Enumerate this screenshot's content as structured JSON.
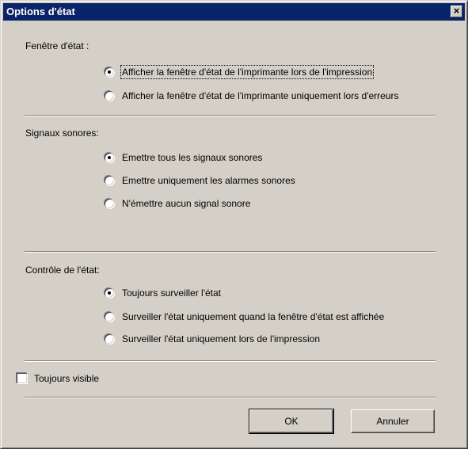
{
  "window": {
    "title": "Options d'état",
    "close_glyph": "×"
  },
  "status_window": {
    "label": "Fenêtre d'état :",
    "options": [
      {
        "label": "Afficher la fenêtre d'état de l'imprimante lors de l'impression",
        "checked": true
      },
      {
        "label": "Afficher la fenêtre d'état de l'imprimante uniquement lors d'erreurs",
        "checked": false
      }
    ]
  },
  "sound_signals": {
    "label": "Signaux sonores:",
    "options": [
      {
        "label": "Emettre tous les signaux sonores",
        "checked": true
      },
      {
        "label": "Emettre uniquement les alarmes sonores",
        "checked": false
      },
      {
        "label": "N'émettre aucun signal sonore",
        "checked": false
      }
    ]
  },
  "status_control": {
    "label": "Contrôle de l'état:",
    "options": [
      {
        "label": "Toujours surveiller l'état",
        "checked": true
      },
      {
        "label": "Surveiller l'état uniquement quand la fenêtre d'état est affichée",
        "checked": false
      },
      {
        "label": "Surveiller l'état uniquement lors de l'impression",
        "checked": false
      }
    ]
  },
  "always_visible": {
    "label": "Toujours visible",
    "checked": false
  },
  "buttons": {
    "ok": "OK",
    "cancel": "Annuler"
  }
}
